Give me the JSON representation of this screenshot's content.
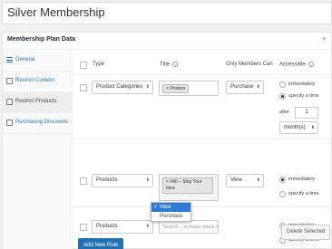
{
  "title": "Silver Membership",
  "metabox": {
    "title": "Membership Plan Data",
    "toggle_icon": "close-x"
  },
  "sidebar": [
    {
      "label": "General",
      "icon": "list-icon"
    },
    {
      "label": "Restrict Content",
      "icon": "doc-icon"
    },
    {
      "label": "Restrict Products",
      "icon": "box-icon"
    },
    {
      "label": "Purchasing Discounts",
      "icon": "doc-icon"
    }
  ],
  "table": {
    "headers": {
      "type": "Type",
      "title": "Title",
      "only_members": "Only Members Can",
      "accessible": "Accessible"
    },
    "rows": [
      {
        "type": "Product Categories",
        "title_tag": "Posters",
        "action": "Purchase",
        "immediately": "immediately",
        "specify": "specify a time",
        "after_label": "after",
        "after_value": "1",
        "unit": "month(s)"
      },
      {
        "type": "Products",
        "title_tag": "#40 – Ship Your Idea",
        "action": "View",
        "immediately": "immediately",
        "specify": "specify a time"
      },
      {
        "type": "Products",
        "title_placeholder": "Search... or leave blank t",
        "action_options": [
          "View",
          "Purchase"
        ],
        "action_selected": "View",
        "immediately": "immediately",
        "specify": "specify a time"
      }
    ]
  },
  "buttons": {
    "add_rule": "Add New Rule",
    "delete_selected": "Delete Selected"
  }
}
